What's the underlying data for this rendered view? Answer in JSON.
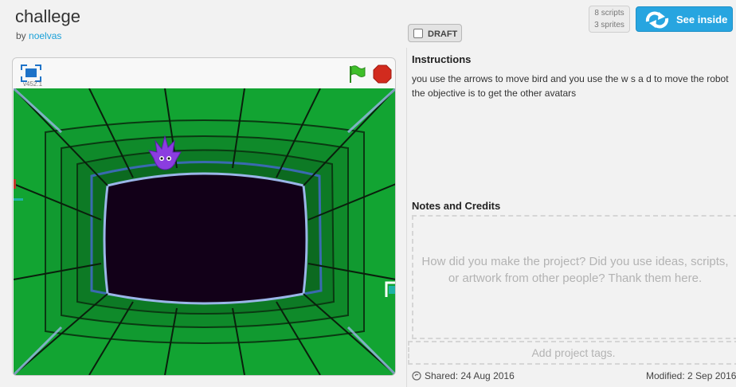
{
  "project": {
    "title": "challege",
    "by_label": "by",
    "author": "noelvas",
    "draft_label": "DRAFT",
    "scripts_count": "8 scripts",
    "sprites_count": "3 sprites",
    "see_inside_label": "See inside"
  },
  "player": {
    "version": "v452.1",
    "icons": [
      "fullscreen-icon",
      "green-flag-icon",
      "stop-icon"
    ],
    "colors": {
      "stage_green": "#12a432",
      "tunnel_dark": "#120018",
      "sprite_purple": "#8b3de0"
    }
  },
  "instructions": {
    "heading": "Instructions",
    "text": "you use the arrows to move bird and you use the w s a d to move the robot the objective is to get the other avatars"
  },
  "notes": {
    "heading": "Notes and Credits",
    "placeholder": "How did you make the project? Did you use ideas, scripts, or artwork from other people? Thank them here."
  },
  "tags": {
    "placeholder": "Add project tags."
  },
  "footer": {
    "shared": "Shared: 24 Aug 2016",
    "modified": "Modified: 2 Sep 2016"
  },
  "colors": {
    "accent": "#27a5e0",
    "link": "#1aa0d8"
  }
}
